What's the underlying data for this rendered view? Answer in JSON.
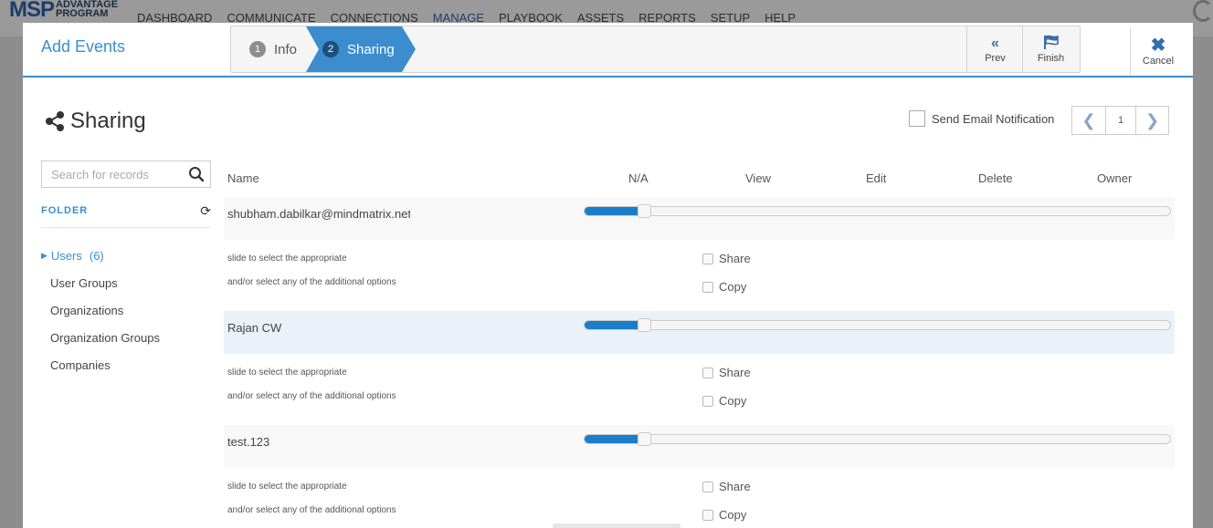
{
  "app": {
    "logo_main": "MSP",
    "logo_sub_1": "ADVANTAGE",
    "logo_sub_2": "PROGRAM",
    "nav": [
      "DASHBOARD",
      "COMMUNICATE",
      "CONNECTIONS",
      "MANAGE",
      "PLAYBOOK",
      "ASSETS",
      "REPORTS",
      "SETUP",
      "HELP"
    ],
    "active_nav": "MANAGE"
  },
  "modal": {
    "title": "Add Events",
    "steps": [
      {
        "number": "1",
        "label": "Info",
        "state": "done"
      },
      {
        "number": "2",
        "label": "Sharing",
        "state": "active"
      }
    ],
    "prev_label": "Prev",
    "finish_label": "Finish",
    "cancel_label": "Cancel",
    "accent_color": "#3b8dce"
  },
  "sharing": {
    "title": "Sharing",
    "notify_label": "Send Email Notification",
    "notify_checked": false,
    "page_number": "1"
  },
  "sidebar": {
    "search_placeholder": "Search for records",
    "folder_header": "FOLDER",
    "items": [
      {
        "label": "Users",
        "count": "(6)",
        "active": true
      },
      {
        "label": "User Groups"
      },
      {
        "label": "Organizations"
      },
      {
        "label": "Organization Groups"
      },
      {
        "label": "Companies"
      }
    ]
  },
  "table": {
    "columns": [
      "Name",
      "N/A",
      "View",
      "Edit",
      "Delete",
      "Owner"
    ],
    "hint_line_1": "slide to select the appropriate",
    "hint_line_2": "and/or select any of the additional options",
    "share_label": "Share",
    "copy_label": "Copy",
    "rows": [
      {
        "name": "shubham.dabilkar@mindmatrix.net",
        "access_level": 0.1,
        "share": false,
        "copy": false
      },
      {
        "name": "Rajan CW",
        "access_level": 0.1,
        "share": false,
        "copy": false
      },
      {
        "name": "test.123",
        "access_level": 0.1,
        "share": false,
        "copy": false
      }
    ]
  }
}
